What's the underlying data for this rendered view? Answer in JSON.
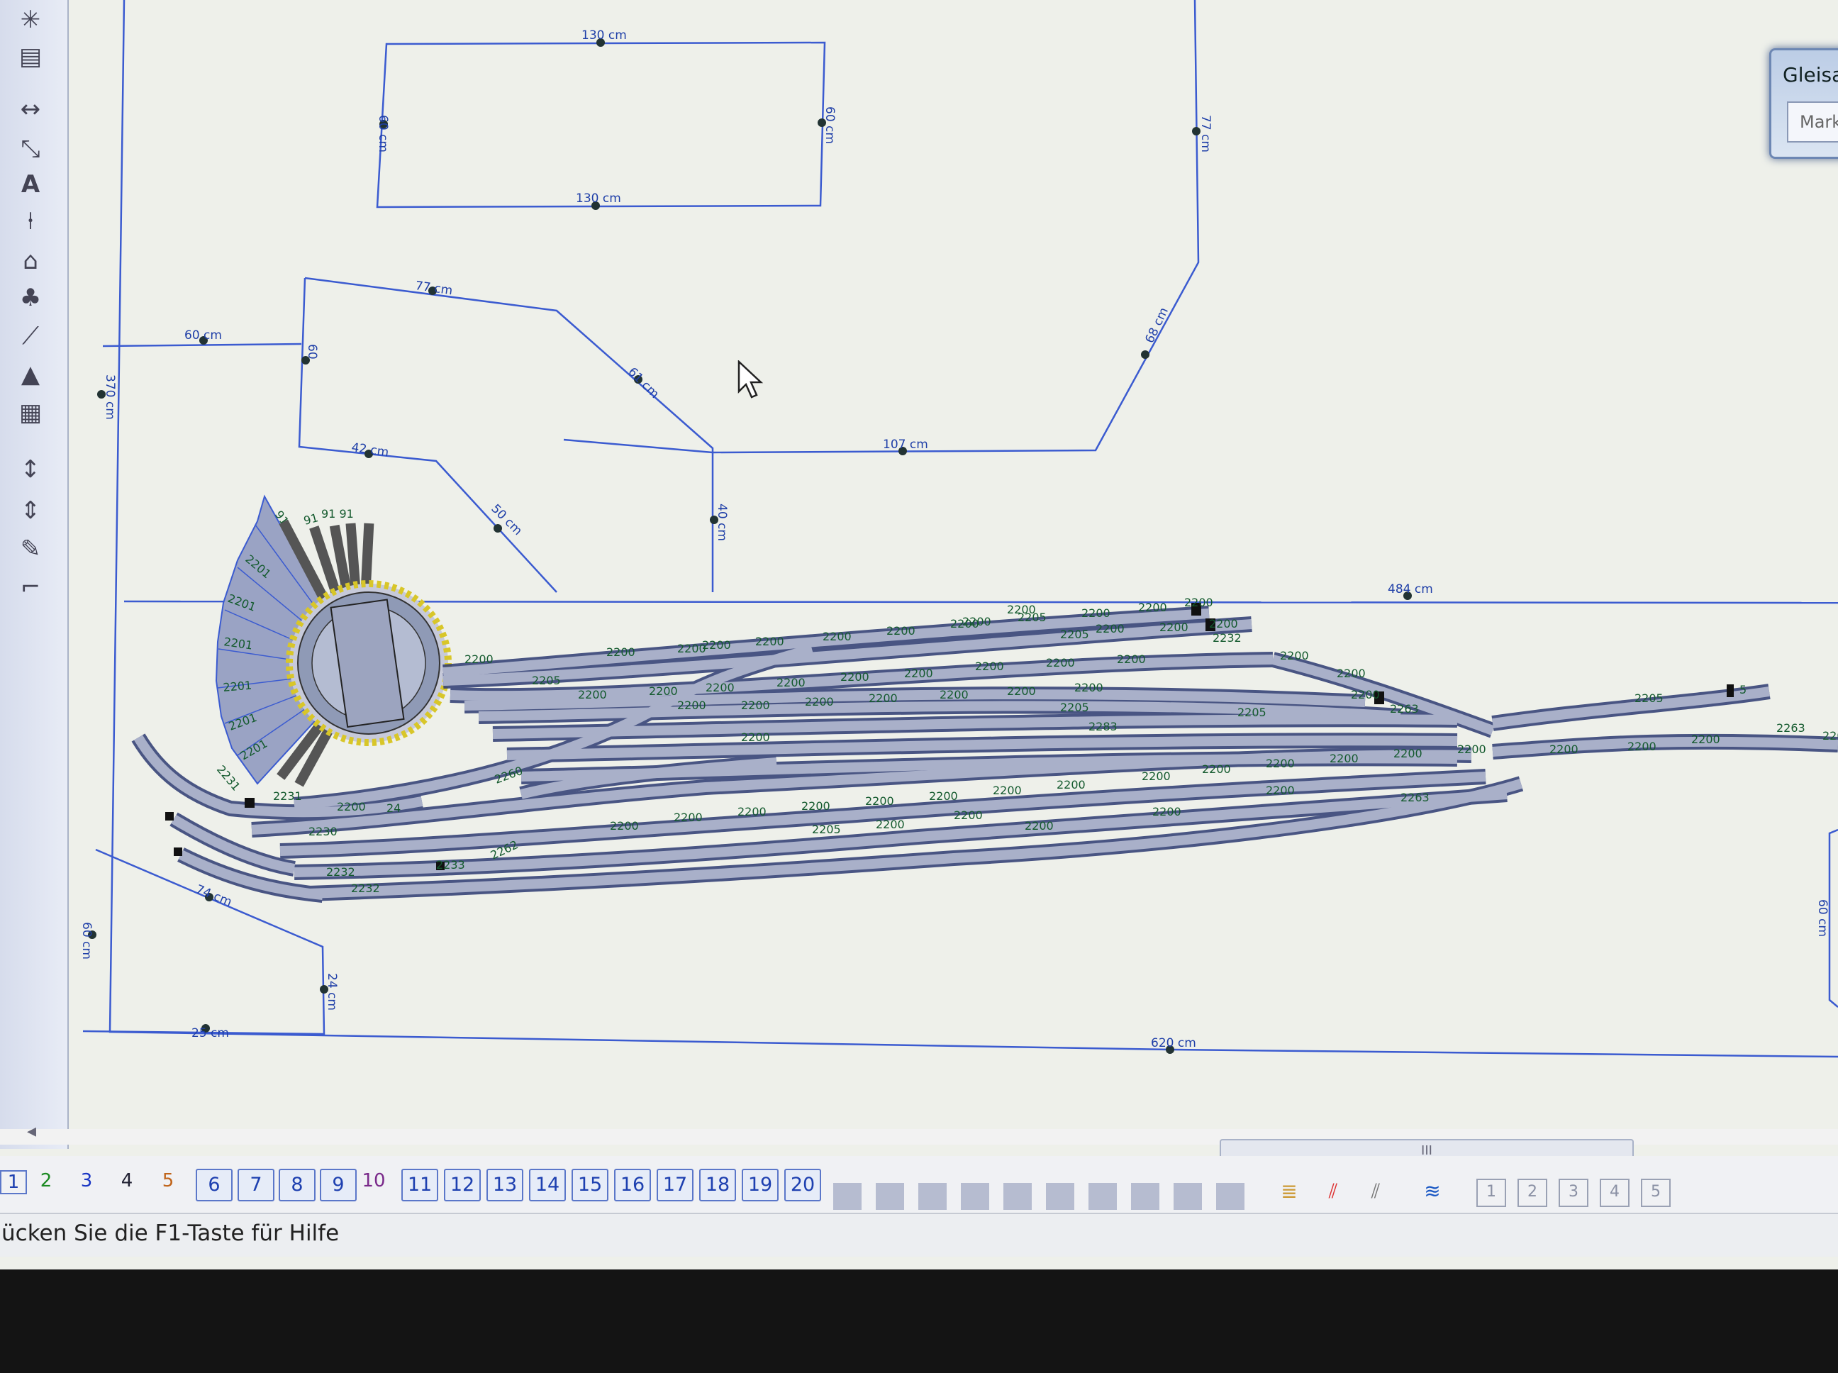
{
  "dialog": {
    "title": "Gleisa",
    "field": "Mark"
  },
  "status": {
    "text": "ücken Sie die  F1-Taste für Hilfe"
  },
  "pages": [
    "1",
    "2",
    "3",
    "4",
    "5",
    "6",
    "7",
    "8",
    "9",
    "10",
    "11",
    "12",
    "13",
    "14",
    "15",
    "16",
    "17",
    "18",
    "19",
    "20"
  ],
  "dimensions": {
    "top_width": "130 cm",
    "bottom_width": "130 cm",
    "left_h": "60 cm",
    "right_h": "60 cm",
    "right_edge": "77 cm",
    "diag_right": "68 cm",
    "mid_top": "77 cm",
    "mid_diag": "61 cm",
    "left_top": "60 cm",
    "left_short": "60",
    "outer_left": "370 cm",
    "mid_bottom": "107 cm",
    "low_left": "42 cm",
    "low_diag": "50 cm",
    "mid_vert": "40 cm",
    "bench_right": "484 cm",
    "lower_left_diag": "74 cm",
    "lower_left_vert": "24 cm",
    "lower_left_h": "60 cm",
    "lower_left_bottom": "25 cm",
    "far_right": "60 cm",
    "bottom_total": "620 cm"
  },
  "track_labels": {
    "fan": [
      "91",
      "91",
      "91 91",
      "2201",
      "2201",
      "2201",
      "2201",
      "2201",
      "2201"
    ],
    "upper": [
      "2200",
      "2205",
      "2200",
      "2200",
      "2200",
      "2200",
      "2200",
      "2200",
      "2200",
      "2200",
      "2205",
      "2200",
      "2200",
      "2200",
      "2200",
      "2205",
      "2200",
      "2200",
      "2232",
      "2200",
      "2200",
      "2200",
      "2263",
      "2200"
    ],
    "middle": [
      "2200",
      "2200",
      "2200",
      "2200",
      "2200",
      "2200",
      "2200",
      "2200",
      "2200",
      "2200",
      "2200",
      "2200",
      "2200",
      "2200",
      "2200",
      "2200",
      "2205",
      "2205",
      "2200",
      "2283"
    ],
    "lower": [
      "2200",
      "2200",
      "2200",
      "2200",
      "2200",
      "2200",
      "2200",
      "2200",
      "2200",
      "2200",
      "2200",
      "2200",
      "2200",
      "2200",
      "2205",
      "2200",
      "2200",
      "2200",
      "2200",
      "2200",
      "2263"
    ],
    "left_curves": [
      "2231",
      "2231",
      "2230",
      "2232",
      "2232",
      "2262",
      "2233",
      "2200",
      "24",
      "2260"
    ],
    "right_extra": [
      "2205",
      "5",
      "2200",
      "2200",
      "2263",
      "2200",
      "2200"
    ]
  },
  "left_tools": [
    "sun-icon",
    "grid-icon",
    "dimension-icon",
    "measure-icon",
    "text-icon",
    "signal-icon",
    "house-icon",
    "tree-icon",
    "slope-icon",
    "terrain-icon",
    "landscape-icon",
    "ruler-icon",
    "ruler-v-icon",
    "pen-icon",
    "corner-icon"
  ]
}
